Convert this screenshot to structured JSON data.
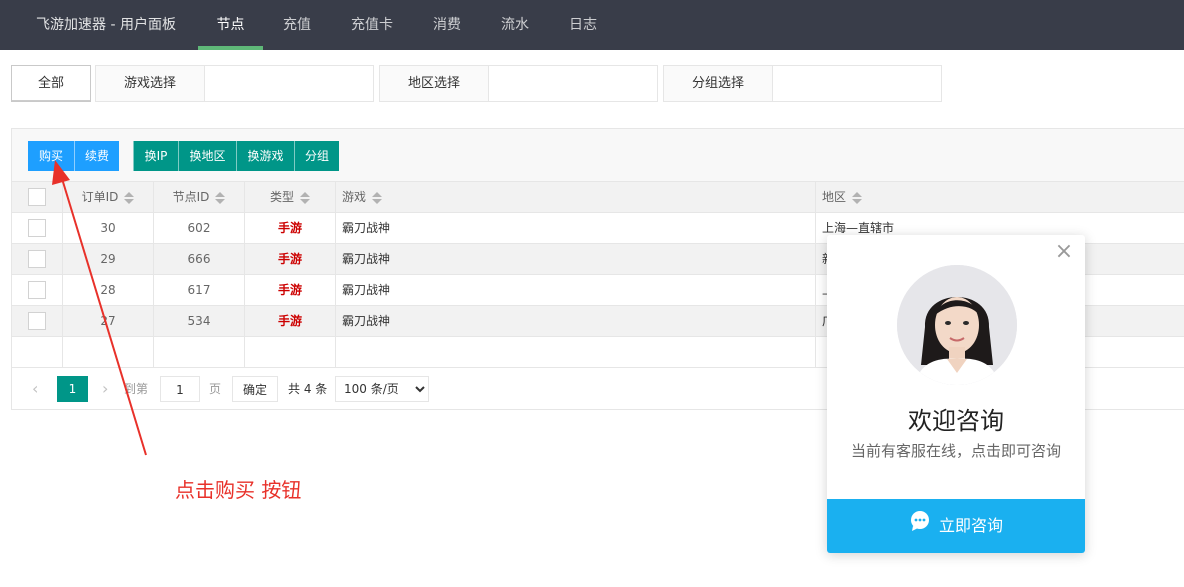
{
  "nav": {
    "brand": "飞游加速器 - 用户面板",
    "items": [
      {
        "label": "节点",
        "active": true
      },
      {
        "label": "充值",
        "active": false
      },
      {
        "label": "充值卡",
        "active": false
      },
      {
        "label": "消费",
        "active": false
      },
      {
        "label": "流水",
        "active": false
      },
      {
        "label": "日志",
        "active": false
      }
    ]
  },
  "filters": {
    "all_label": "全部",
    "game_label": "游戏选择",
    "region_label": "地区选择",
    "group_label": "分组选择"
  },
  "toolbar": {
    "buy": "购买",
    "renew": "续费",
    "change_ip": "换IP",
    "change_region": "换地区",
    "change_game": "换游戏",
    "group": "分组"
  },
  "table": {
    "headers": {
      "order_id": "订单ID",
      "node_id": "节点ID",
      "type": "类型",
      "game": "游戏",
      "region": "地区"
    },
    "rows": [
      {
        "order_id": "30",
        "node_id": "602",
        "type": "手游",
        "game": "霸刀战神",
        "region": "上海—直辖市"
      },
      {
        "order_id": "29",
        "node_id": "666",
        "type": "手游",
        "game": "霸刀战神",
        "region": "新"
      },
      {
        "order_id": "28",
        "node_id": "617",
        "type": "手游",
        "game": "霸刀战神",
        "region": "上"
      },
      {
        "order_id": "27",
        "node_id": "534",
        "type": "手游",
        "game": "霸刀战神",
        "region": "广"
      }
    ]
  },
  "pager": {
    "prev_icon": "chevron-left-icon",
    "next_icon": "chevron-right-icon",
    "current_page": "1",
    "goto_label": "到第",
    "page_input": "1",
    "page_unit": "页",
    "confirm": "确定",
    "total": "共 4 条",
    "page_size": "100 条/页"
  },
  "annotation": {
    "text": "点击购买 按钮",
    "color": "#e8312a"
  },
  "chat_popup": {
    "title": "欢迎咨询",
    "subtitle": "当前有客服在线，点击即可咨询",
    "cta": "立即咨询",
    "close_icon": "close-icon",
    "cta_icon": "chat-bubble-icon"
  },
  "colors": {
    "nav_bg": "#393d49",
    "nav_active": "#5fb878",
    "blue_btn": "#1e9fff",
    "green_btn": "#009688",
    "cta": "#1ab0f0"
  }
}
